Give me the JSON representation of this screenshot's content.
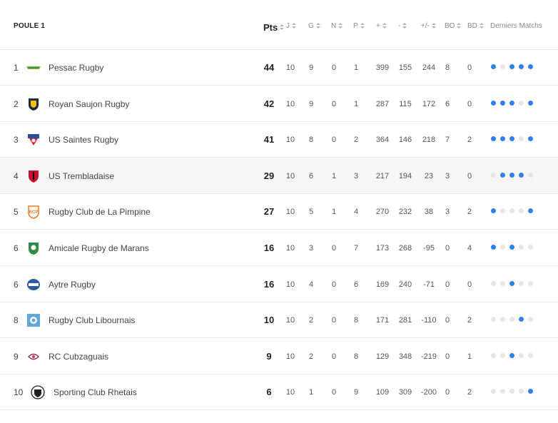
{
  "header": {
    "title": "POULE 1",
    "columns": [
      "Pts",
      "J",
      "G",
      "N",
      "P",
      "+",
      "-",
      "+/-",
      "BO",
      "BD",
      "Derniers Matchs"
    ]
  },
  "colors": {
    "win": "#2f80ed",
    "other": "#e6e6e6"
  },
  "rows": [
    {
      "rank": "1",
      "team": "Pessac Rugby",
      "logo": "pessac-logo",
      "pts": "44",
      "j": "10",
      "g": "9",
      "n": "0",
      "p": "1",
      "plus": "399",
      "minus": "155",
      "diff": "244",
      "bo": "8",
      "bd": "0",
      "form": [
        1,
        0,
        1,
        1,
        1
      ]
    },
    {
      "rank": "2",
      "team": "Royan Saujon Rugby",
      "logo": "royan-logo",
      "pts": "42",
      "j": "10",
      "g": "9",
      "n": "0",
      "p": "1",
      "plus": "287",
      "minus": "115",
      "diff": "172",
      "bo": "6",
      "bd": "0",
      "form": [
        1,
        1,
        1,
        0,
        1
      ]
    },
    {
      "rank": "3",
      "team": "US Saintes Rugby",
      "logo": "saintes-logo",
      "pts": "41",
      "j": "10",
      "g": "8",
      "n": "0",
      "p": "2",
      "plus": "364",
      "minus": "146",
      "diff": "218",
      "bo": "7",
      "bd": "2",
      "form": [
        1,
        1,
        1,
        0,
        1
      ]
    },
    {
      "rank": "4",
      "team": "US Trembladaise",
      "logo": "trembladaise-logo",
      "pts": "29",
      "j": "10",
      "g": "6",
      "n": "1",
      "p": "3",
      "plus": "217",
      "minus": "194",
      "diff": "23",
      "bo": "3",
      "bd": "0",
      "form": [
        0,
        1,
        1,
        1,
        0
      ]
    },
    {
      "rank": "5",
      "team": "Rugby Club de La Pimpine",
      "logo": "pimpine-logo",
      "pts": "27",
      "j": "10",
      "g": "5",
      "n": "1",
      "p": "4",
      "plus": "270",
      "minus": "232",
      "diff": "38",
      "bo": "3",
      "bd": "2",
      "form": [
        1,
        0,
        0,
        0,
        1
      ]
    },
    {
      "rank": "6",
      "team": "Amicale Rugby de Marans",
      "logo": "marans-logo",
      "pts": "16",
      "j": "10",
      "g": "3",
      "n": "0",
      "p": "7",
      "plus": "173",
      "minus": "268",
      "diff": "-95",
      "bo": "0",
      "bd": "4",
      "form": [
        1,
        0,
        1,
        0,
        0
      ]
    },
    {
      "rank": "6",
      "team": "Aytre Rugby",
      "logo": "aytre-logo",
      "pts": "16",
      "j": "10",
      "g": "4",
      "n": "0",
      "p": "6",
      "plus": "169",
      "minus": "240",
      "diff": "-71",
      "bo": "0",
      "bd": "0",
      "form": [
        0,
        0,
        1,
        0,
        0
      ]
    },
    {
      "rank": "8",
      "team": "Rugby Club Libournais",
      "logo": "libournais-logo",
      "pts": "10",
      "j": "10",
      "g": "2",
      "n": "0",
      "p": "8",
      "plus": "171",
      "minus": "281",
      "diff": "-110",
      "bo": "0",
      "bd": "2",
      "form": [
        0,
        0,
        0,
        1,
        0
      ]
    },
    {
      "rank": "9",
      "team": "RC Cubzaguais",
      "logo": "cubzaguais-logo",
      "pts": "9",
      "j": "10",
      "g": "2",
      "n": "0",
      "p": "8",
      "plus": "129",
      "minus": "348",
      "diff": "-219",
      "bo": "0",
      "bd": "1",
      "form": [
        0,
        0,
        1,
        0,
        0
      ]
    },
    {
      "rank": "10",
      "team": "Sporting Club Rhetais",
      "logo": "rhetais-logo",
      "pts": "6",
      "j": "10",
      "g": "1",
      "n": "0",
      "p": "9",
      "plus": "109",
      "minus": "309",
      "diff": "-200",
      "bo": "0",
      "bd": "2",
      "form": [
        0,
        0,
        0,
        0,
        1
      ]
    }
  ]
}
